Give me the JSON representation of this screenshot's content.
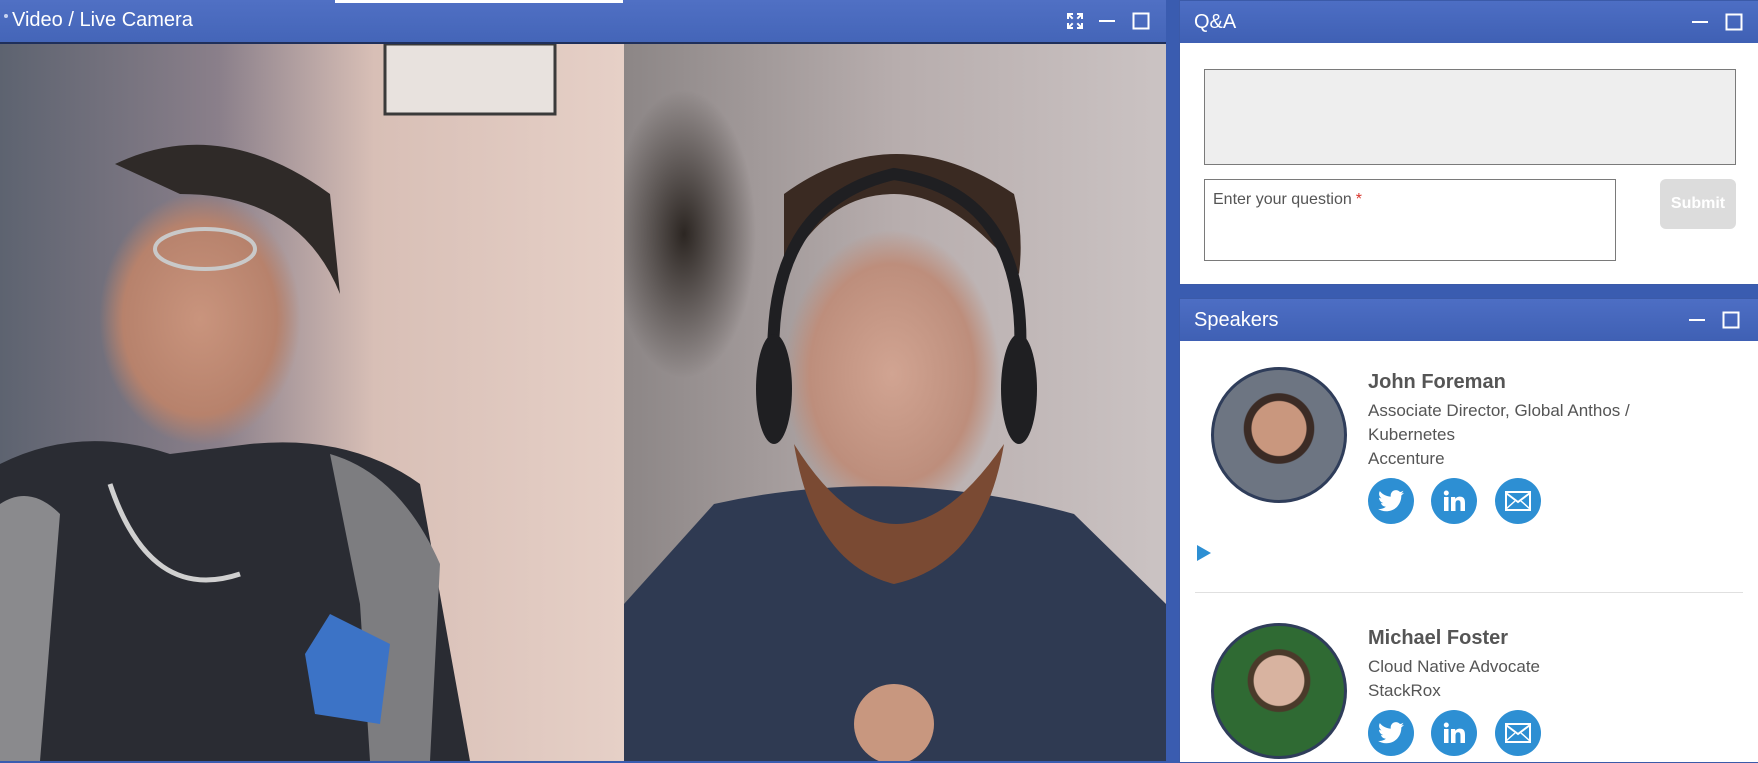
{
  "video": {
    "title": "Video / Live Camera",
    "controls": [
      "fullscreen-icon",
      "minimize-icon",
      "maximize-icon"
    ]
  },
  "qa": {
    "title": "Q&A",
    "question_label": "Enter your question",
    "required_marker": "*",
    "submit_label": "Submit",
    "controls": [
      "minimize-icon",
      "maximize-icon"
    ]
  },
  "speakers": {
    "title": "Speakers",
    "controls": [
      "minimize-icon",
      "maximize-icon"
    ],
    "list": [
      {
        "name": "John Foreman",
        "title_line1": "Associate Director, Global Anthos /",
        "title_line2": "Kubernetes",
        "company": "Accenture",
        "social": [
          "twitter-icon",
          "linkedin-icon",
          "email-icon"
        ]
      },
      {
        "name": "Michael Foster",
        "title_line1": "Cloud Native Advocate",
        "company": "StackRox",
        "social": [
          "twitter-icon",
          "linkedin-icon",
          "email-icon"
        ]
      }
    ]
  },
  "colors": {
    "titlebar": "#4465b8",
    "social_blue": "#2d8fd3",
    "submit_disabled": "#dcdcdc",
    "required": "#d9342b"
  }
}
